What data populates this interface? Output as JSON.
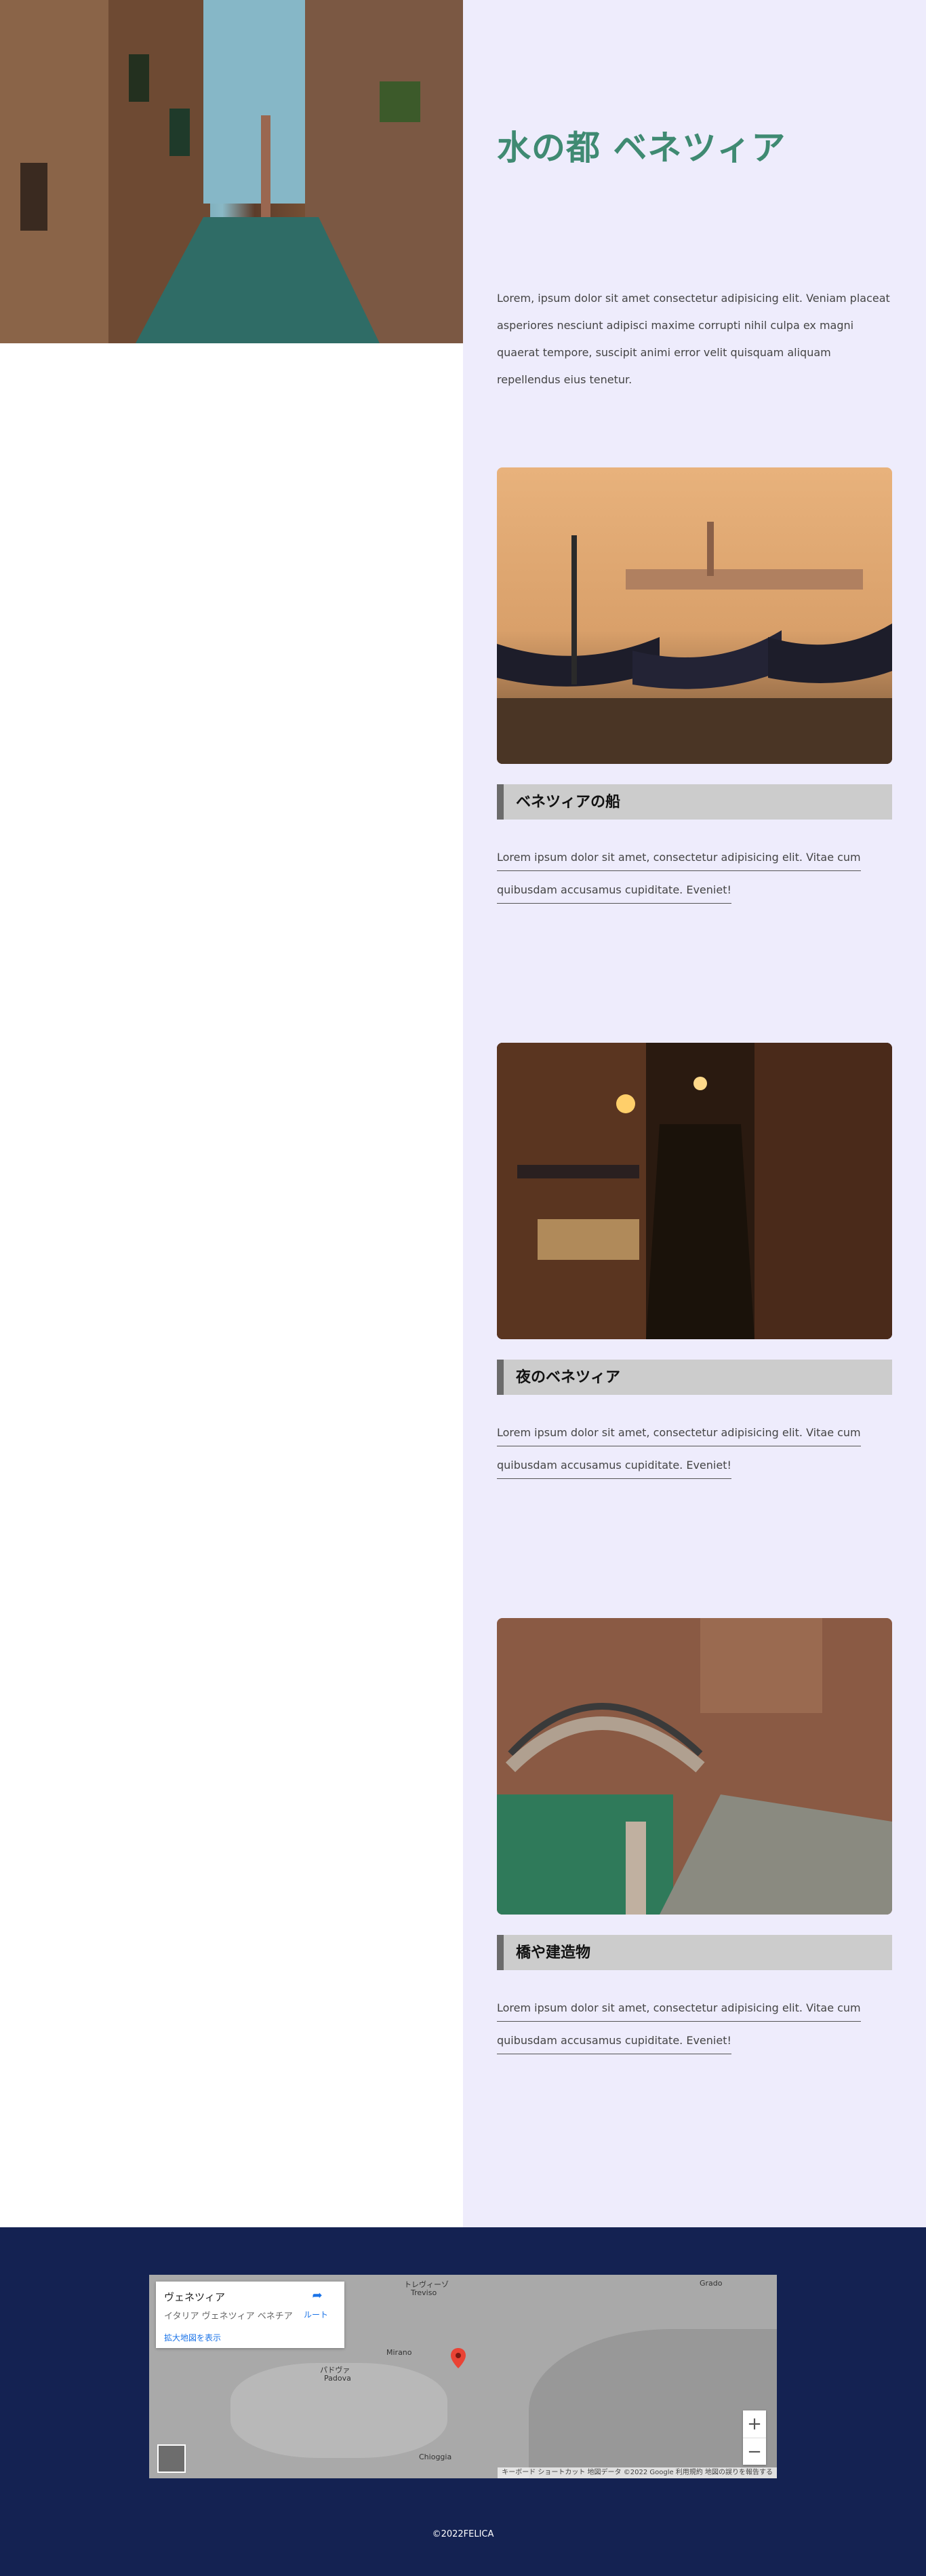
{
  "site": {
    "title": "水の都 ベネツィア",
    "intro": "Lorem, ipsum dolor sit amet consectetur adipisicing elit. Veniam placeat asperiores nesciunt adipisci maxime corrupti nihil culpa ex magni quaerat tempore, suscipit animi error velit quisquam aliquam repellendus eius tenetur."
  },
  "cards": [
    {
      "heading": "ベネツィアの船",
      "text": "Lorem ipsum dolor sit amet, consectetur adipisicing elit. Vitae cum quibusdam accusamus cupiditate. Eveniet!"
    },
    {
      "heading": "夜のベネツィア",
      "text": "Lorem ipsum dolor sit amet, consectetur adipisicing elit. Vitae cum quibusdam accusamus cupiditate. Eveniet!"
    },
    {
      "heading": "橋や建造物",
      "text": "Lorem ipsum dolor sit amet, consectetur adipisicing elit. Vitae cum quibusdam accusamus cupiditate. Eveniet!"
    }
  ],
  "map": {
    "place_name": "ヴェネツィア",
    "address": "イタリア ヴェネツィア ベネチア",
    "view_larger": "拡大地図を表示",
    "route_label": "ルート",
    "zoom_in": "+",
    "zoom_out": "−",
    "attribution": "キーボード ショートカット  地図データ ©2022 Google  利用規約  地図の誤りを報告する",
    "cities": [
      "トレヴィーゾ",
      "Treviso",
      "パドヴァ",
      "Padova",
      "Mirano",
      "Chioggia",
      "Grado"
    ]
  },
  "footer": {
    "copyright": "©2022FELICA"
  }
}
